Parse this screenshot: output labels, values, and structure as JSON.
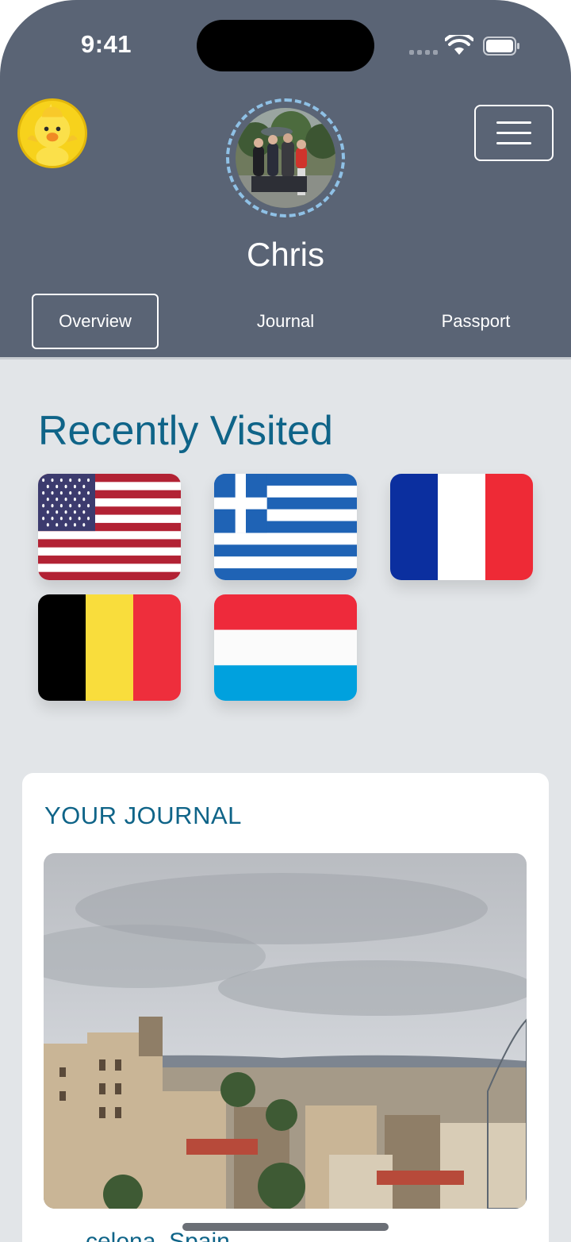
{
  "status_bar": {
    "time": "9:41"
  },
  "header": {
    "profile_name": "Chris",
    "tabs": [
      {
        "label": "Overview",
        "active": true
      },
      {
        "label": "Journal",
        "active": false
      },
      {
        "label": "Passport",
        "active": false
      }
    ],
    "colors": {
      "background": "#5a6475",
      "ring": "#8fc1e6"
    },
    "icons": {
      "left": "duck-avatar-icon",
      "right": "hamburger-menu-icon"
    }
  },
  "recently_visited": {
    "title": "Recently Visited",
    "flags": [
      {
        "country": "United States",
        "icon": "usa-flag"
      },
      {
        "country": "Greece",
        "icon": "greece-flag"
      },
      {
        "country": "France",
        "icon": "france-flag"
      },
      {
        "country": "Belgium",
        "icon": "belgium-flag"
      },
      {
        "country": "Luxembourg",
        "icon": "luxembourg-flag"
      }
    ]
  },
  "journal": {
    "title": "YOUR JOURNAL",
    "caption": "celona, Spain"
  },
  "theme": {
    "accent": "#0f6488",
    "page_background": "#e2e5e8"
  }
}
